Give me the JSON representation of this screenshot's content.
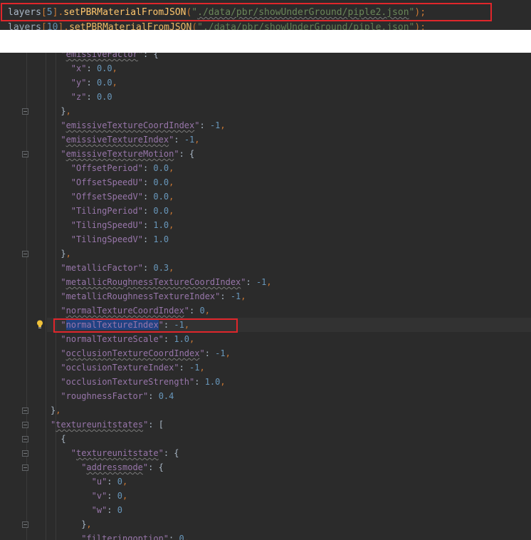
{
  "top_code": {
    "line1": {
      "var": "layers",
      "index": "5",
      "method": "setPBRMaterialFromJSON",
      "path": "./data/pbr/showUnderGround/piple2.json"
    },
    "line2": {
      "var": "layers",
      "index": "10",
      "method": "setPBRMaterialFromJSON",
      "path": "./data/pbr/showUnderGround/piple.json"
    }
  },
  "json_lines": [
    {
      "indent": 3,
      "key": "emissiveFactor",
      "sep": ": {",
      "partial": true
    },
    {
      "indent": 4,
      "key": "x",
      "value": "0.0",
      "comma": true
    },
    {
      "indent": 4,
      "key": "y",
      "value": "0.0",
      "comma": true
    },
    {
      "indent": 4,
      "key": "z",
      "value": "0.0",
      "comma": false
    },
    {
      "indent": 3,
      "close": "}",
      "comma": true
    },
    {
      "indent": 3,
      "key": "emissiveTextureCoordIndex",
      "value": "-1",
      "comma": true
    },
    {
      "indent": 3,
      "key": "emissiveTextureIndex",
      "value": "-1",
      "comma": true
    },
    {
      "indent": 3,
      "key": "emissiveTextureMotion",
      "open": "{"
    },
    {
      "indent": 4,
      "key": "OffsetPeriod",
      "value": "0.0",
      "comma": true
    },
    {
      "indent": 4,
      "key": "OffsetSpeedU",
      "value": "0.0",
      "comma": true
    },
    {
      "indent": 4,
      "key": "OffsetSpeedV",
      "value": "0.0",
      "comma": true
    },
    {
      "indent": 4,
      "key": "TilingPeriod",
      "value": "0.0",
      "comma": true
    },
    {
      "indent": 4,
      "key": "TilingSpeedU",
      "value": "1.0",
      "comma": true
    },
    {
      "indent": 4,
      "key": "TilingSpeedV",
      "value": "1.0",
      "comma": false
    },
    {
      "indent": 3,
      "close": "}",
      "comma": true
    },
    {
      "indent": 3,
      "key": "metallicFactor",
      "value": "0.3",
      "comma": true
    },
    {
      "indent": 3,
      "key": "metallicRoughnessTextureCoordIndex",
      "value": "-1",
      "comma": true
    },
    {
      "indent": 3,
      "key": "metallicRoughnessTextureIndex",
      "value": "-1",
      "comma": true
    },
    {
      "indent": 3,
      "key": "normalTextureCoordIndex",
      "value": "0",
      "comma": true
    },
    {
      "indent": 3,
      "key": "normalTextureIndex",
      "value": "-1",
      "comma": true,
      "highlight": true
    },
    {
      "indent": 3,
      "key": "normalTextureScale",
      "value": "1.0",
      "comma": true
    },
    {
      "indent": 3,
      "key": "occlusionTextureCoordIndex",
      "value": "-1",
      "comma": true
    },
    {
      "indent": 3,
      "key": "occlusionTextureIndex",
      "value": "-1",
      "comma": true
    },
    {
      "indent": 3,
      "key": "occlusionTextureStrength",
      "value": "1.0",
      "comma": true
    },
    {
      "indent": 3,
      "key": "roughnessFactor",
      "value": "0.4",
      "comma": false
    },
    {
      "indent": 2,
      "close": "}",
      "comma": true
    },
    {
      "indent": 2,
      "key": "textureunitstates",
      "open": "["
    },
    {
      "indent": 3,
      "close": "{",
      "comma": false
    },
    {
      "indent": 4,
      "key": "textureunitstate",
      "open": "{"
    },
    {
      "indent": 5,
      "key": "addressmode",
      "open": "{"
    },
    {
      "indent": 6,
      "key": "u",
      "value": "0",
      "comma": true
    },
    {
      "indent": 6,
      "key": "v",
      "value": "0",
      "comma": true
    },
    {
      "indent": 6,
      "key": "w",
      "value": "0",
      "comma": false
    },
    {
      "indent": 5,
      "close": "}",
      "comma": true
    },
    {
      "indent": 5,
      "key": "filteringoption",
      "value": "0",
      "comma": true,
      "partial": true
    }
  ],
  "colors": {
    "background": "#2b2b2b",
    "key": "#9876aa",
    "number": "#6897bb",
    "punctuation": "#cc7832",
    "highlight_box": "#e0262b",
    "selection": "#214283"
  },
  "icons": {
    "intention": "lightbulb-icon",
    "fold": "fold-marker-icon"
  }
}
